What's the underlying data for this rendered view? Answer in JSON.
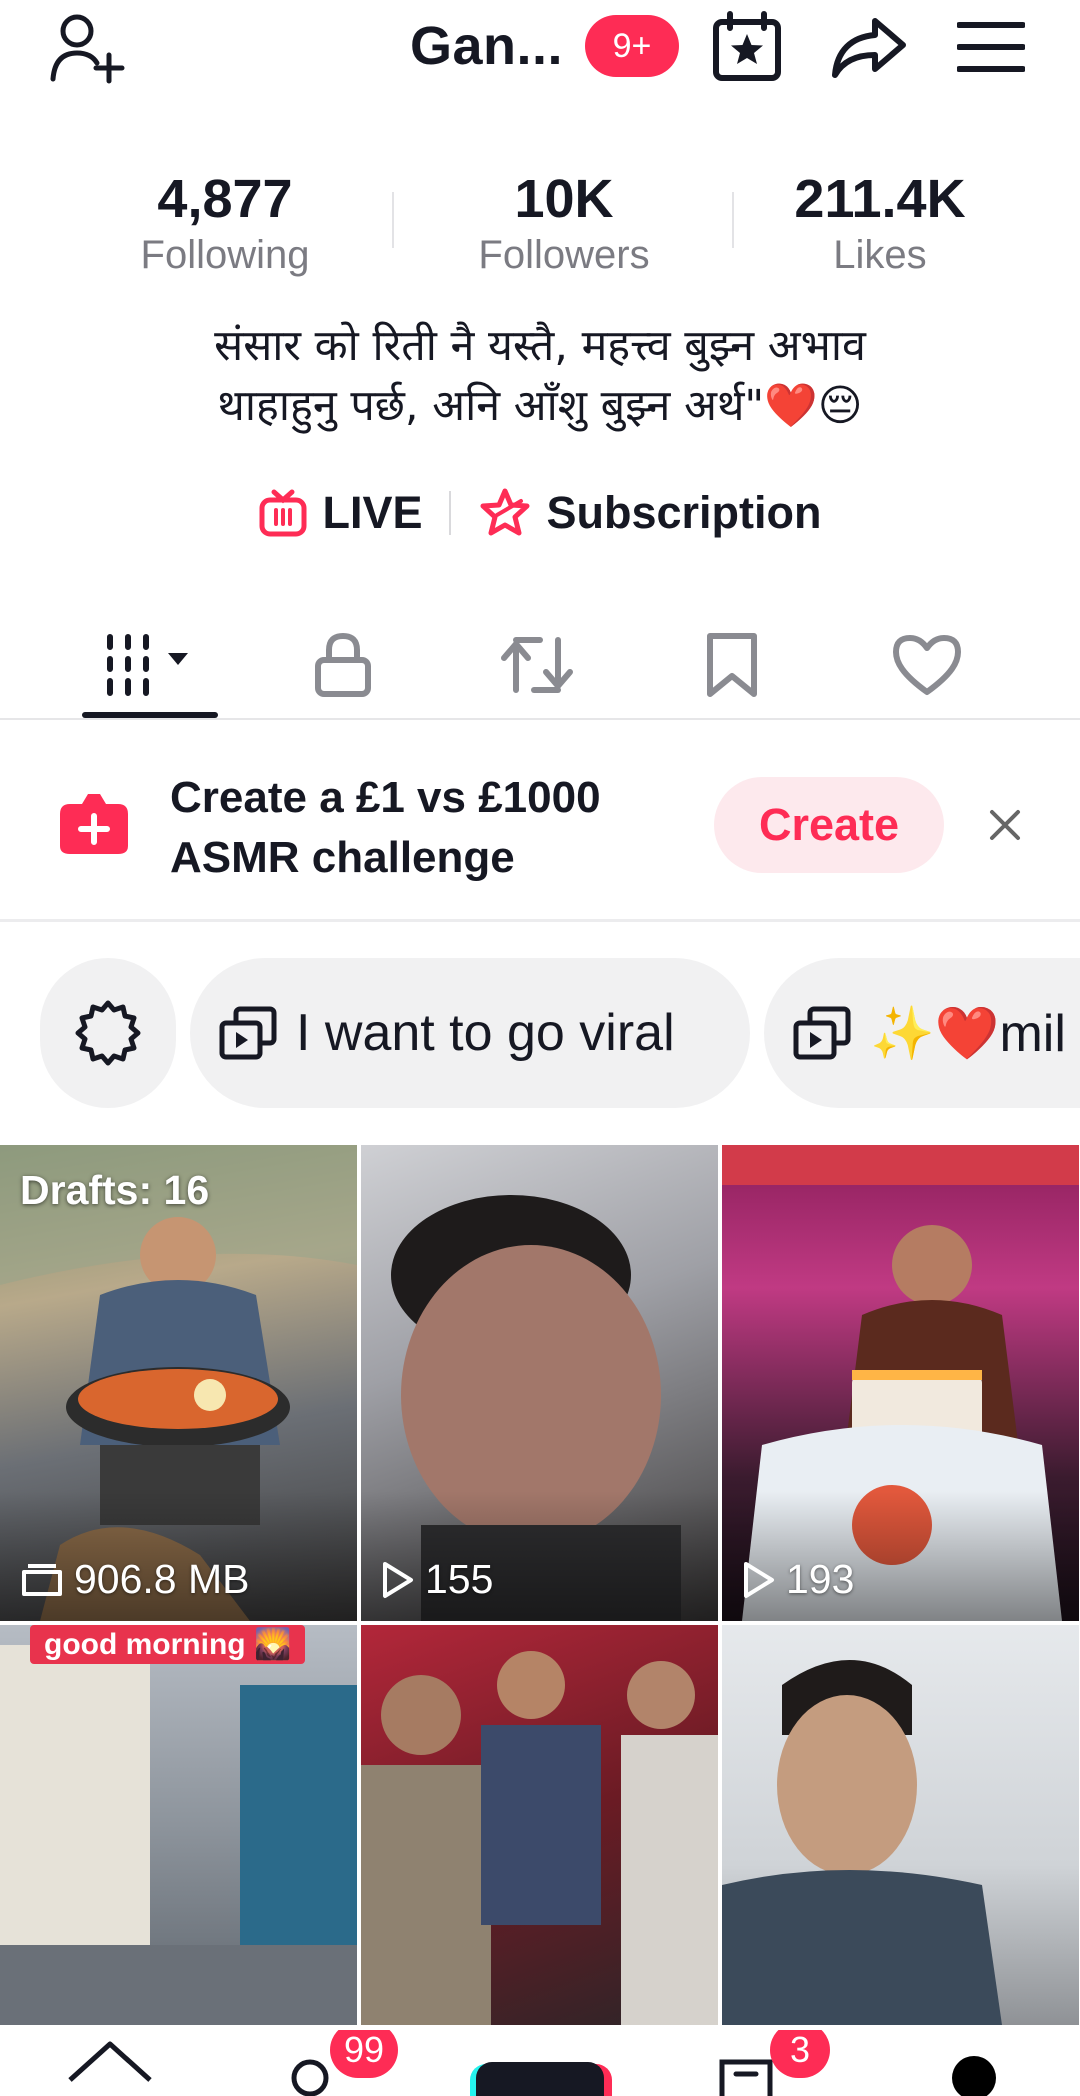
{
  "header": {
    "title": "Gan...",
    "notification_badge": "9+"
  },
  "stats": [
    {
      "value": "4,877",
      "label": "Following"
    },
    {
      "value": "10K",
      "label": "Followers"
    },
    {
      "value": "211.4K",
      "label": "Likes"
    }
  ],
  "bio": "संसार को रिती नै यस्तै, महत्त्व बुझ्न अभाव\nथाहाहुनु पर्छ, अनि आँशु बुझ्न अर्थ\"❤️😔",
  "links": {
    "live_label": "LIVE",
    "subscription_label": "Subscription"
  },
  "promo": {
    "text": "Create a £1 vs £1000 ASMR challenge",
    "create_label": "Create"
  },
  "playlists": [
    {
      "label": "I want to go viral"
    },
    {
      "label": "✨❤️mil"
    }
  ],
  "videos": [
    {
      "kind": "drafts",
      "drafts_label": "Drafts: 16",
      "count": "906.8 MB"
    },
    {
      "kind": "video",
      "count": "155"
    },
    {
      "kind": "video",
      "count": "193"
    },
    {
      "kind": "video",
      "caption_tag": "good morning 🌄"
    },
    {
      "kind": "video"
    },
    {
      "kind": "video"
    }
  ],
  "bottom_nav": {
    "friends_badge": "99",
    "inbox_badge": "3"
  },
  "colors": {
    "accent": "#fe2c55",
    "text": "#161823",
    "muted": "#7b7b82"
  }
}
